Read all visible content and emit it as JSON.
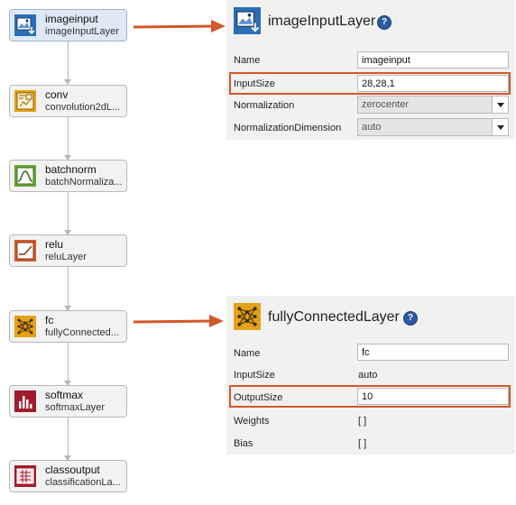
{
  "layers": [
    {
      "name": "imageinput",
      "type": "imageInputLayer"
    },
    {
      "name": "conv",
      "type": "convolution2dL..."
    },
    {
      "name": "batchnorm",
      "type": "batchNormaliza..."
    },
    {
      "name": "relu",
      "type": "reluLayer"
    },
    {
      "name": "fc",
      "type": "fullyConnected..."
    },
    {
      "name": "softmax",
      "type": "softmaxLayer"
    },
    {
      "name": "classoutput",
      "type": "classificationLa..."
    }
  ],
  "panel1": {
    "title": "imageInputLayer",
    "help": "?",
    "rows": [
      {
        "label": "Name",
        "value": "imageinput"
      },
      {
        "label": "InputSize",
        "value": "28,28,1"
      },
      {
        "label": "Normalization",
        "value": "zerocenter"
      },
      {
        "label": "NormalizationDimension",
        "value": "auto"
      }
    ]
  },
  "panel2": {
    "title": "fullyConnectedLayer",
    "help": "?",
    "rows": [
      {
        "label": "Name",
        "value": "fc"
      },
      {
        "label": "InputSize",
        "value": "auto"
      },
      {
        "label": "OutputSize",
        "value": "10"
      },
      {
        "label": "Weights",
        "value": "[ ]"
      },
      {
        "label": "Bias",
        "value": "[ ]"
      }
    ]
  },
  "icons": [
    "image-input-icon",
    "convolution-icon",
    "batchnorm-icon",
    "relu-icon",
    "fully-connected-icon",
    "softmax-icon",
    "classification-icon"
  ],
  "colors": {
    "highlight": "#d2582a",
    "image_input": "#2a6fb5",
    "conv": "#e4a21a",
    "batchnorm": "#6aa33a",
    "relu": "#d2582a",
    "fc": "#e4a21a",
    "softmax": "#a11b2c",
    "classoutput": "#a11b2c"
  }
}
